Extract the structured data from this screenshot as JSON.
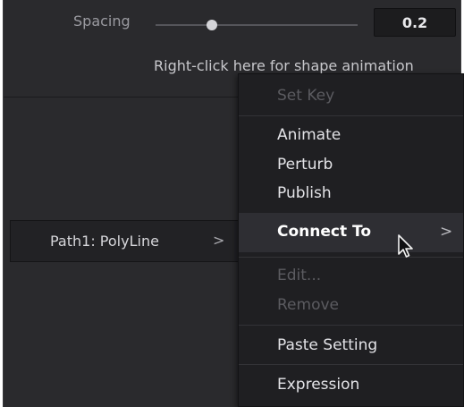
{
  "spacing": {
    "label": "Spacing",
    "value": "0.2",
    "slider_level": 0.28
  },
  "hint_text": "Right-click here for shape animation",
  "path_item": {
    "label": "Path1: PolyLine",
    "chevron": ">"
  },
  "menu": {
    "set_key": "Set Key",
    "animate": "Animate",
    "perturb": "Perturb",
    "publish": "Publish",
    "connect_to": "Connect To",
    "connect_chevron": ">",
    "edit": "Edit...",
    "remove": "Remove",
    "paste_setting": "Paste Setting",
    "expression": "Expression"
  },
  "icons": {
    "cursor": "arrow-pointer-icon",
    "submenu": "chevron-right-icon"
  },
  "colors": {
    "panel_bg": "#2a2a2d",
    "menu_bg": "#1f1f22",
    "disabled_text": "#5b5b60"
  }
}
